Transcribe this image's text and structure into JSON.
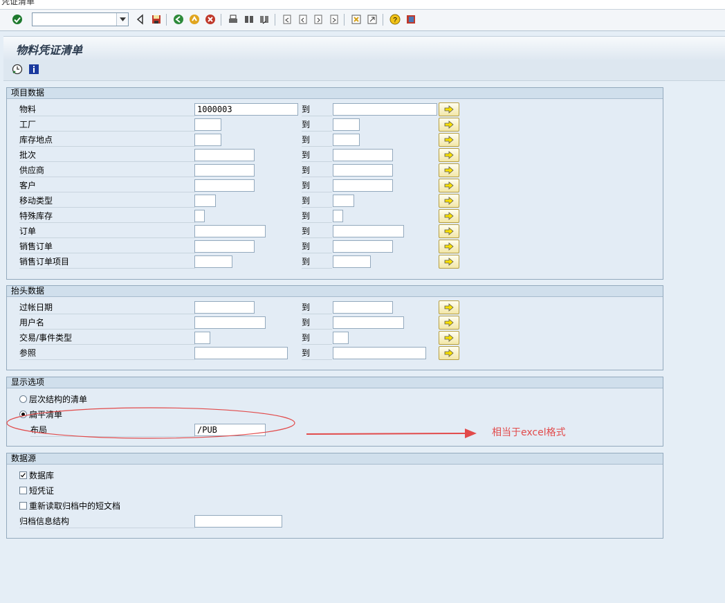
{
  "window": {
    "title_fragment": "凭证清单"
  },
  "toolbar": {
    "command_value": "",
    "icons": [
      "enter-icon",
      "back-icon",
      "save-icon",
      "back-green-icon",
      "exit-icon",
      "cancel-icon",
      "print-icon",
      "find-icon",
      "find-next-icon",
      "first-page-icon",
      "prev-page-icon",
      "next-page-icon",
      "last-page-icon",
      "new-session-icon",
      "shortcut-icon",
      "help-icon",
      "layout-icon"
    ]
  },
  "page": {
    "title": "物料凭证清单"
  },
  "app_toolbar": {
    "icons": [
      "execute-icon",
      "info-icon"
    ]
  },
  "to_label": "到",
  "sections": {
    "items": {
      "title": "项目数据",
      "fields": [
        {
          "label": "物料",
          "low": "1000003",
          "high": ""
        },
        {
          "label": "工厂",
          "low": "",
          "high": ""
        },
        {
          "label": "库存地点",
          "low": "",
          "high": ""
        },
        {
          "label": "批次",
          "low": "",
          "high": ""
        },
        {
          "label": "供应商",
          "low": "",
          "high": ""
        },
        {
          "label": "客户",
          "low": "",
          "high": ""
        },
        {
          "label": "移动类型",
          "low": "",
          "high": ""
        },
        {
          "label": "特殊库存",
          "low": "",
          "high": ""
        },
        {
          "label": "订单",
          "low": "",
          "high": ""
        },
        {
          "label": "销售订单",
          "low": "",
          "high": ""
        },
        {
          "label": "销售订单项目",
          "low": "",
          "high": ""
        }
      ]
    },
    "header": {
      "title": "抬头数据",
      "fields": [
        {
          "label": "过帐日期",
          "low": "",
          "high": ""
        },
        {
          "label": "用户名",
          "low": "",
          "high": ""
        },
        {
          "label": "交易/事件类型",
          "low": "",
          "high": ""
        },
        {
          "label": "参照",
          "low": "",
          "high": ""
        }
      ]
    },
    "display": {
      "title": "显示选项",
      "radio_hierarchical": "层次结构的清单",
      "radio_flat": "扁平清单",
      "selected": "flat",
      "layout_label": "布局",
      "layout_value": "/PUB"
    },
    "datasource": {
      "title": "数据源",
      "db_label": "数据库",
      "db_checked": true,
      "short_doc_label": "短凭证",
      "short_doc_checked": false,
      "reread_label": "重新读取归档中的短文档",
      "reread_checked": false,
      "archive_label": "归档信息结构",
      "archive_value": ""
    }
  },
  "annotation": {
    "text": "相当于excel格式",
    "color": "#e24a4a"
  }
}
